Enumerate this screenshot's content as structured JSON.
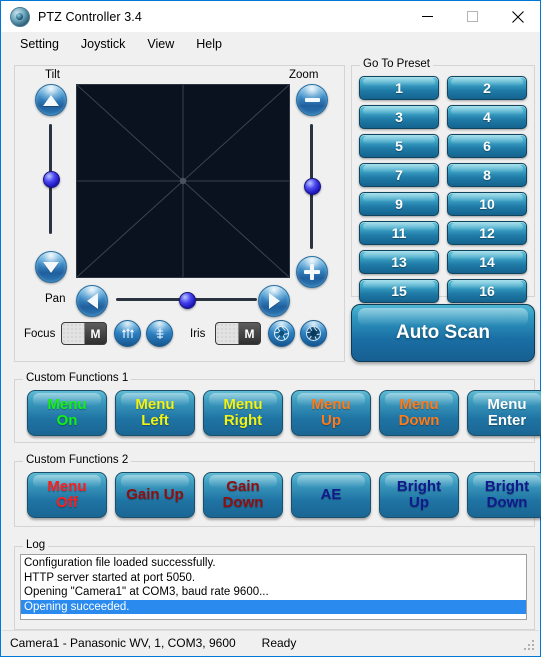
{
  "window": {
    "title": "PTZ Controller 3.4",
    "icon": "camera-lens-icon",
    "controls": {
      "minimize": "minimize-icon",
      "maximize": "maximize-icon",
      "close": "close-icon"
    }
  },
  "menubar": {
    "items": [
      {
        "label": "Setting"
      },
      {
        "label": "Joystick"
      },
      {
        "label": "View"
      },
      {
        "label": "Help"
      }
    ]
  },
  "controls": {
    "tilt_label": "Tilt",
    "pan_label": "Pan",
    "zoom_label": "Zoom",
    "focus_label": "Focus",
    "iris_label": "Iris",
    "focus_mode": "M",
    "iris_mode": "M",
    "tilt_value": 50,
    "pan_value": 50,
    "zoom_value": 50
  },
  "presets": {
    "title": "Go To Preset",
    "buttons": [
      "1",
      "2",
      "3",
      "4",
      "5",
      "6",
      "7",
      "8",
      "9",
      "10",
      "11",
      "12",
      "13",
      "14",
      "15",
      "16"
    ]
  },
  "autoscan": {
    "label": "Auto Scan"
  },
  "custom1": {
    "title": "Custom Functions 1",
    "buttons": [
      {
        "line1": "Menu",
        "line2": "On",
        "color": "#14f014"
      },
      {
        "line1": "Menu",
        "line2": "Left",
        "color": "#f2f213"
      },
      {
        "line1": "Menu",
        "line2": "Right",
        "color": "#f2f213"
      },
      {
        "line1": "Menu",
        "line2": "Up",
        "color": "#ff7a18"
      },
      {
        "line1": "Menu",
        "line2": "Down",
        "color": "#ff7a18"
      },
      {
        "line1": "Menu",
        "line2": "Enter",
        "color": "#ffffff"
      }
    ]
  },
  "custom2": {
    "title": "Custom Functions 2",
    "buttons": [
      {
        "line1": "Menu",
        "line2": "Off",
        "color": "#ff1d1d"
      },
      {
        "line1": "Gain Up",
        "line2": "",
        "color": "#8f0f0f"
      },
      {
        "line1": "Gain",
        "line2": "Down",
        "color": "#8f0f0f"
      },
      {
        "line1": "AE",
        "line2": "",
        "color": "#111a8c"
      },
      {
        "line1": "Bright",
        "line2": "Up",
        "color": "#111a8c"
      },
      {
        "line1": "Bright",
        "line2": "Down",
        "color": "#111a8c"
      }
    ]
  },
  "log": {
    "title": "Log",
    "lines": [
      {
        "text": "Configuration file loaded successfully.",
        "selected": false
      },
      {
        "text": "HTTP server started at port 5050.",
        "selected": false
      },
      {
        "text": "Opening \"Camera1\" at COM3, baud rate 9600...",
        "selected": false
      },
      {
        "text": "Opening succeeded.",
        "selected": true
      }
    ]
  },
  "statusbar": {
    "camera": "Camera1 - Panasonic WV, 1, COM3, 9600",
    "state": "Ready"
  },
  "colors": {
    "accent_blue": "#0078d7",
    "preset_top": "#59c4da",
    "preset_bottom": "#15638f",
    "pad_background": "#0a1220",
    "selection": "#2a8aee"
  }
}
